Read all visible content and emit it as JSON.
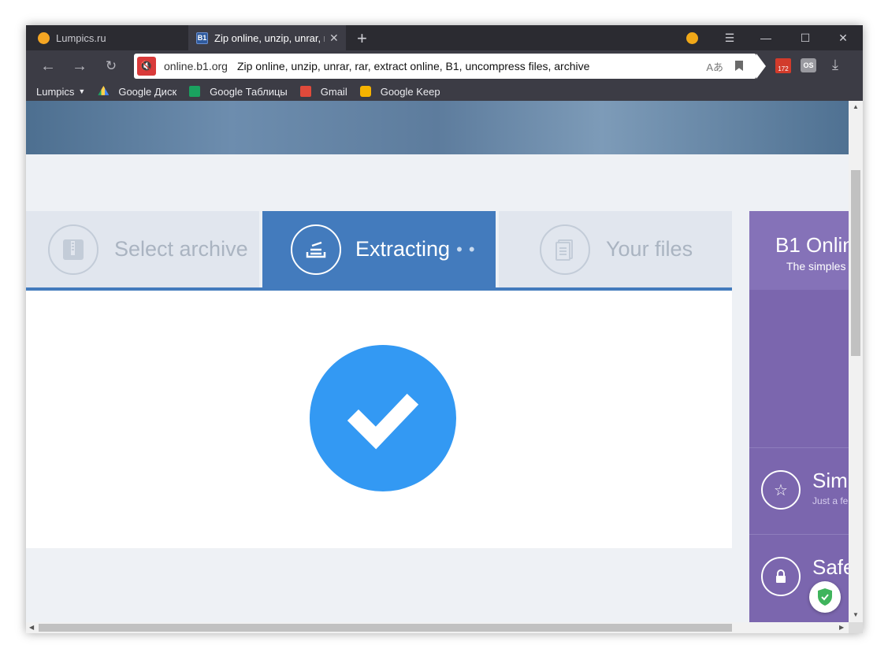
{
  "tabs": [
    {
      "title": "Lumpics.ru",
      "active": false
    },
    {
      "title": "Zip online, unzip, unrar, r",
      "favicon_text": "B1",
      "active": true
    }
  ],
  "address_bar": {
    "domain": "online.b1.org",
    "page_title": "Zip online, unzip, unrar, rar, extract online, B1, uncompress files, archive"
  },
  "extensions": {
    "badge_count": "172",
    "os_label": "OS"
  },
  "bookmarks": [
    {
      "label": "Lumpics",
      "has_dropdown": true
    },
    {
      "label": "Google Диск"
    },
    {
      "label": "Google Таблицы"
    },
    {
      "label": "Gmail"
    },
    {
      "label": "Google Keep"
    }
  ],
  "steps": [
    {
      "label": "Select archive",
      "state": "done"
    },
    {
      "label": "Extracting",
      "state": "active",
      "dots": "• •"
    },
    {
      "label": "Your files",
      "state": "pending"
    }
  ],
  "sidebar": {
    "title": "B1 Onlin",
    "subtitle": "The simples",
    "features": [
      {
        "title": "Simp",
        "subtitle": "Just a fe",
        "icon": "star-icon"
      },
      {
        "title": "Safe",
        "subtitle": "",
        "icon": "lock-icon"
      }
    ]
  },
  "colors": {
    "active_step": "#437bbd",
    "check_circle": "#3399f3",
    "sidebar": "#7b66ae"
  }
}
